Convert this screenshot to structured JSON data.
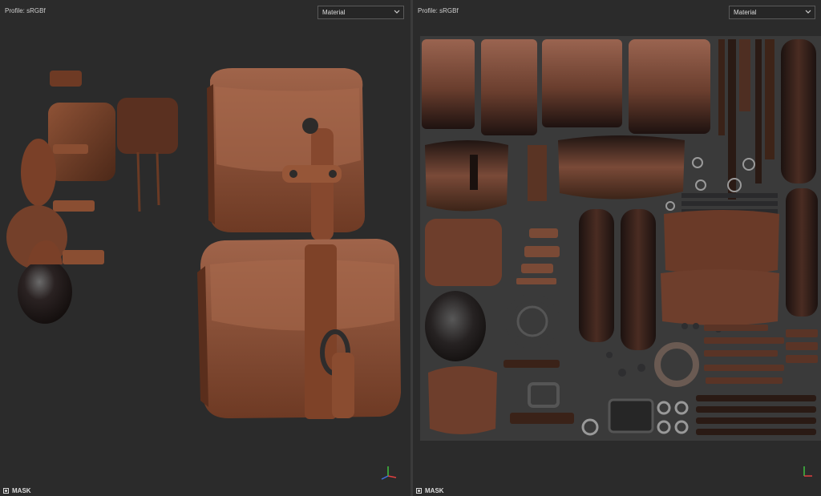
{
  "viewports": {
    "left": {
      "profile_label": "Profile: sRGBf",
      "channel_select": "Material",
      "mask_label": "MASK"
    },
    "right": {
      "profile_label": "Profile: sRGBf",
      "channel_select": "Material",
      "mask_label": "MASK"
    }
  },
  "gizmo": {
    "x_axis": "x",
    "y_axis": "y",
    "z_axis": "z"
  },
  "colors": {
    "viewport_bg": "#2b2b2b",
    "uv_sheet_bg": "#3a3a3a",
    "leather_light": "#9a5b3e",
    "leather_mid": "#7a4028",
    "leather_dark": "#3e2216",
    "metal": "#2a2a2c",
    "axis_x": "#e04040",
    "axis_y": "#40c040",
    "axis_z": "#4070e0"
  },
  "icons": [
    "chevron-down-icon",
    "mask-icon",
    "axis-gizmo-icon"
  ]
}
